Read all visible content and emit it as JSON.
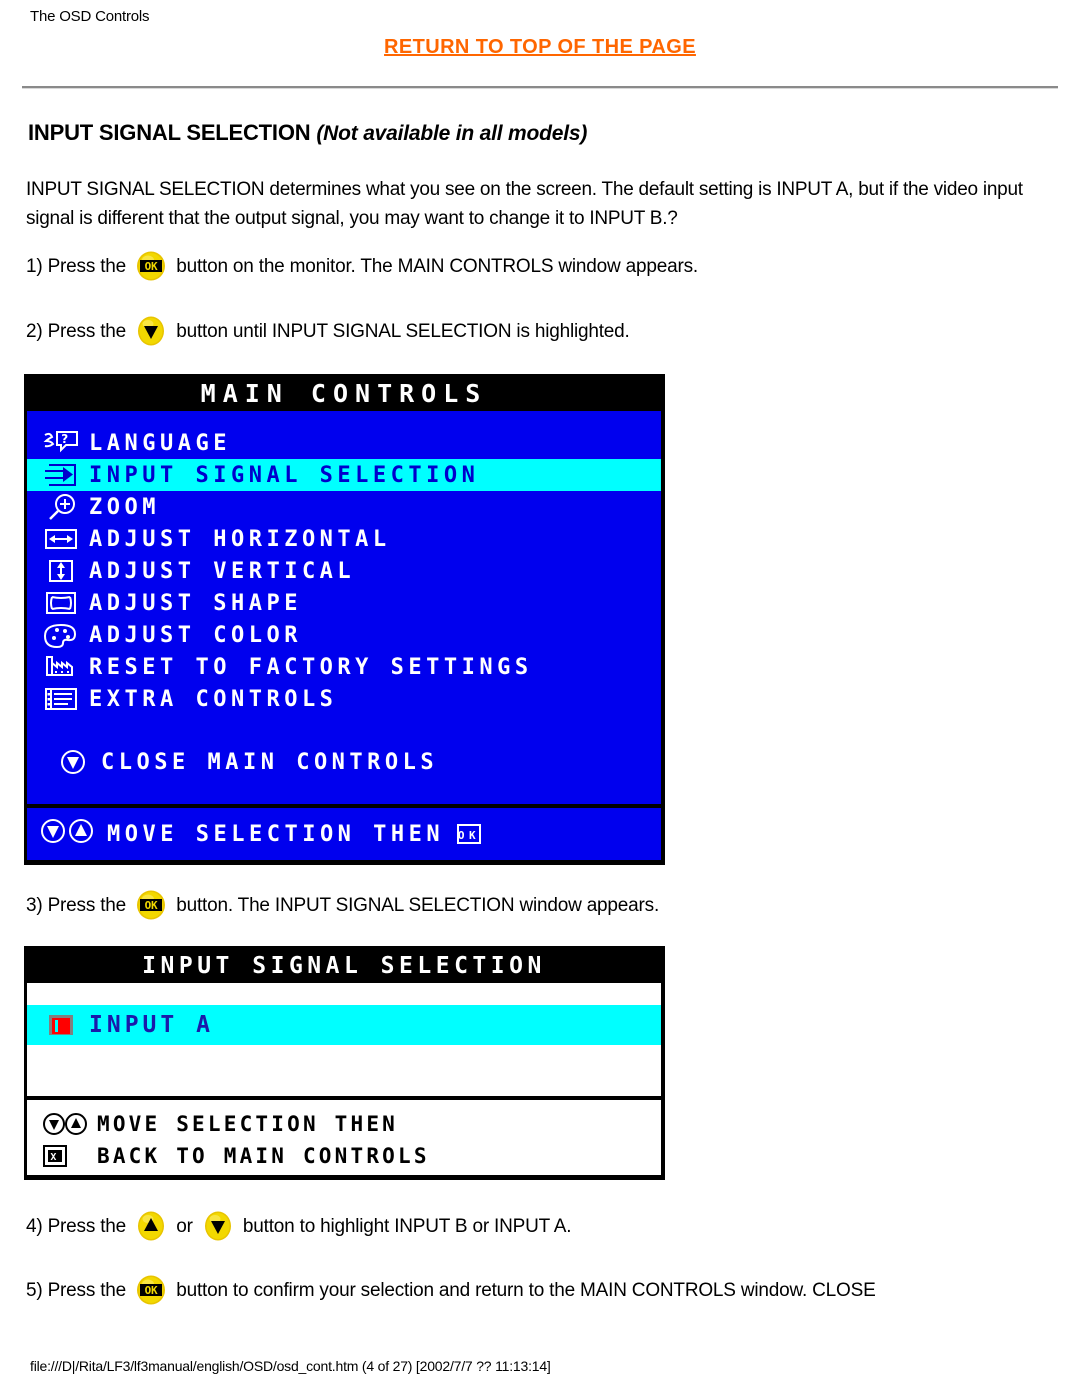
{
  "header": {
    "page_title": "The OSD Controls",
    "return_link": "RETURN TO TOP OF THE PAGE",
    "link_color": "#ff6600"
  },
  "section": {
    "title": "INPUT SIGNAL SELECTION",
    "title_note": "(Not available in all models)",
    "intro": "INPUT SIGNAL SELECTION determines what you see on the screen. The default setting is INPUT A, but if the video input signal is different that the output signal, you may want to change it to INPUT B.?"
  },
  "steps": {
    "s1_pre": "1) Press the",
    "s1_post": "button on the monitor. The MAIN CONTROLS window appears.",
    "s2_pre": "2) Press the",
    "s2_post": "button until INPUT SIGNAL SELECTION is highlighted.",
    "s3_pre": "3) Press the",
    "s3_post": "button. The INPUT SIGNAL SELECTION window appears.",
    "s4_pre": "4) Press the",
    "s4_mid": "or",
    "s4_post": "button to highlight INPUT B or INPUT A.",
    "s5_pre": "5) Press the",
    "s5_post": "button to confirm your selection and return to the MAIN CONTROLS window. CLOSE"
  },
  "osd_main": {
    "title": "MAIN CONTROLS",
    "background": "#0000ee",
    "highlight": "#00ffff",
    "items": [
      {
        "icon": "language-icon",
        "label": "LANGUAGE",
        "selected": false
      },
      {
        "icon": "input-signal-icon",
        "label": "INPUT SIGNAL SELECTION",
        "selected": true
      },
      {
        "icon": "zoom-icon",
        "label": "ZOOM",
        "selected": false
      },
      {
        "icon": "adjust-horizontal-icon",
        "label": "ADJUST HORIZONTAL",
        "selected": false
      },
      {
        "icon": "adjust-vertical-icon",
        "label": "ADJUST VERTICAL",
        "selected": false
      },
      {
        "icon": "adjust-shape-icon",
        "label": "ADJUST SHAPE",
        "selected": false
      },
      {
        "icon": "adjust-color-icon",
        "label": "ADJUST COLOR",
        "selected": false
      },
      {
        "icon": "factory-reset-icon",
        "label": "RESET TO FACTORY SETTINGS",
        "selected": false
      },
      {
        "icon": "extra-controls-icon",
        "label": "EXTRA CONTROLS",
        "selected": false
      }
    ],
    "close_item": {
      "icon": "down-arrow-circle-icon",
      "label": "CLOSE MAIN CONTROLS"
    },
    "footer": {
      "label": "MOVE SELECTION THEN",
      "icons": [
        "down-arrow-circle-icon",
        "up-arrow-circle-icon"
      ],
      "trailing_icon": "ok-button-icon"
    }
  },
  "osd_input": {
    "title": "INPUT SIGNAL SELECTION",
    "background": "#ffffff",
    "highlight": "#00ffff",
    "items": [
      {
        "icon": "input-a-icon",
        "label": "INPUT A",
        "selected": true
      }
    ],
    "footer_line_1": "MOVE SELECTION THEN",
    "footer_line_2": "BACK TO MAIN CONTROLS"
  },
  "footer": {
    "path": "file:///D|/Rita/LF3/lf3manual/english/OSD/osd_cont.htm (4 of 27) [2002/7/7 ?? 11:13:14]"
  }
}
